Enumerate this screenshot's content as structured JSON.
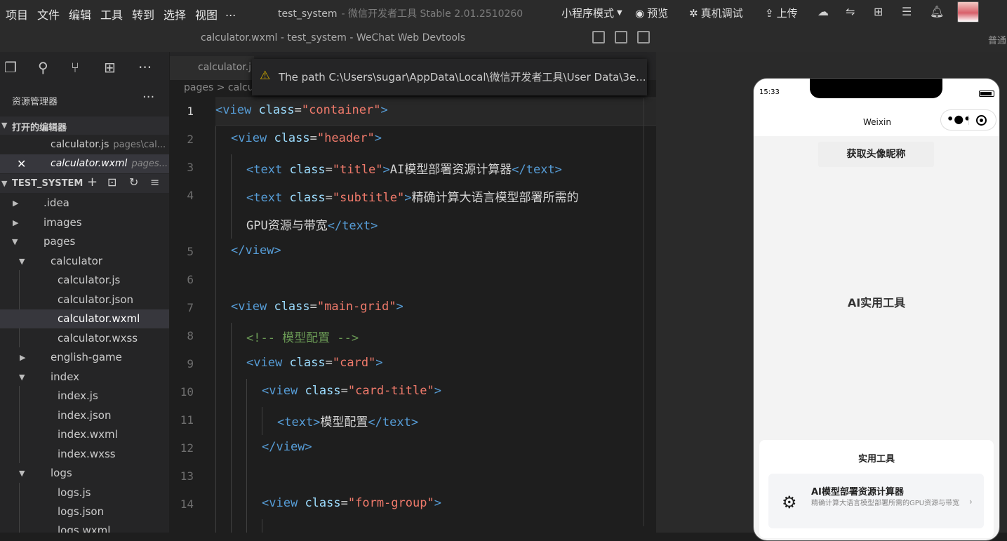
{
  "menubar": {
    "items": [
      "项目",
      "文件",
      "编辑",
      "工具",
      "转到",
      "选择",
      "视图",
      "..."
    ],
    "app_title": "test_system",
    "app_subtitle": "- 微信开发者工具 Stable 2.01.2510260",
    "mode": "小程序模式",
    "preview": "预览",
    "real_debug": "真机调试",
    "upload": "上传"
  },
  "window": {
    "title": "calculator.wxml - test_system - WeChat Web Devtools"
  },
  "simulator": {
    "label": "普通"
  },
  "explorer": {
    "title": "资源管理器",
    "more": "···",
    "open_editors_header": "打开的编辑器",
    "open_editors": [
      {
        "name": "calculator.js",
        "desc": "pages\\cal..."
      },
      {
        "name": "calculator.wxml",
        "desc": "pages..."
      }
    ],
    "project_header": "TEST_SYSTEM",
    "tree": [
      {
        "label": ".idea"
      },
      {
        "label": "images"
      },
      {
        "label": "pages"
      },
      {
        "label": "calculator"
      },
      {
        "label": "calculator.js"
      },
      {
        "label": "calculator.json"
      },
      {
        "label": "calculator.wxml"
      },
      {
        "label": "calculator.wxss"
      },
      {
        "label": "english-game"
      },
      {
        "label": "index"
      },
      {
        "label": "index.js"
      },
      {
        "label": "index.json"
      },
      {
        "label": "index.wxml"
      },
      {
        "label": "index.wxss"
      },
      {
        "label": "logs"
      },
      {
        "label": "logs.js"
      },
      {
        "label": "logs.json"
      },
      {
        "label": "logs.wxml"
      }
    ]
  },
  "editor": {
    "tab": "calculator.j",
    "breadcrumb": "pages > calcu",
    "toast": "The path C:\\Users\\sugar\\AppData\\Local\\微信开发者工具\\User Data\\3e...",
    "line_numbers": [
      "1",
      "2",
      "3",
      "4",
      "5",
      "6",
      "7",
      "8",
      "9",
      "10",
      "11",
      "12",
      "13",
      "14"
    ]
  },
  "phone": {
    "time": "15:33",
    "nav_title": "Weixin",
    "avatar_button": "获取头像昵称",
    "ai_tools": "AI实用工具",
    "card_title": "实用工具",
    "tool_name": "AI模型部署资源计算器",
    "tool_desc": "精确计算大语言模型部署所需的GPU资源与带宽",
    "tool_arrow": "›"
  }
}
